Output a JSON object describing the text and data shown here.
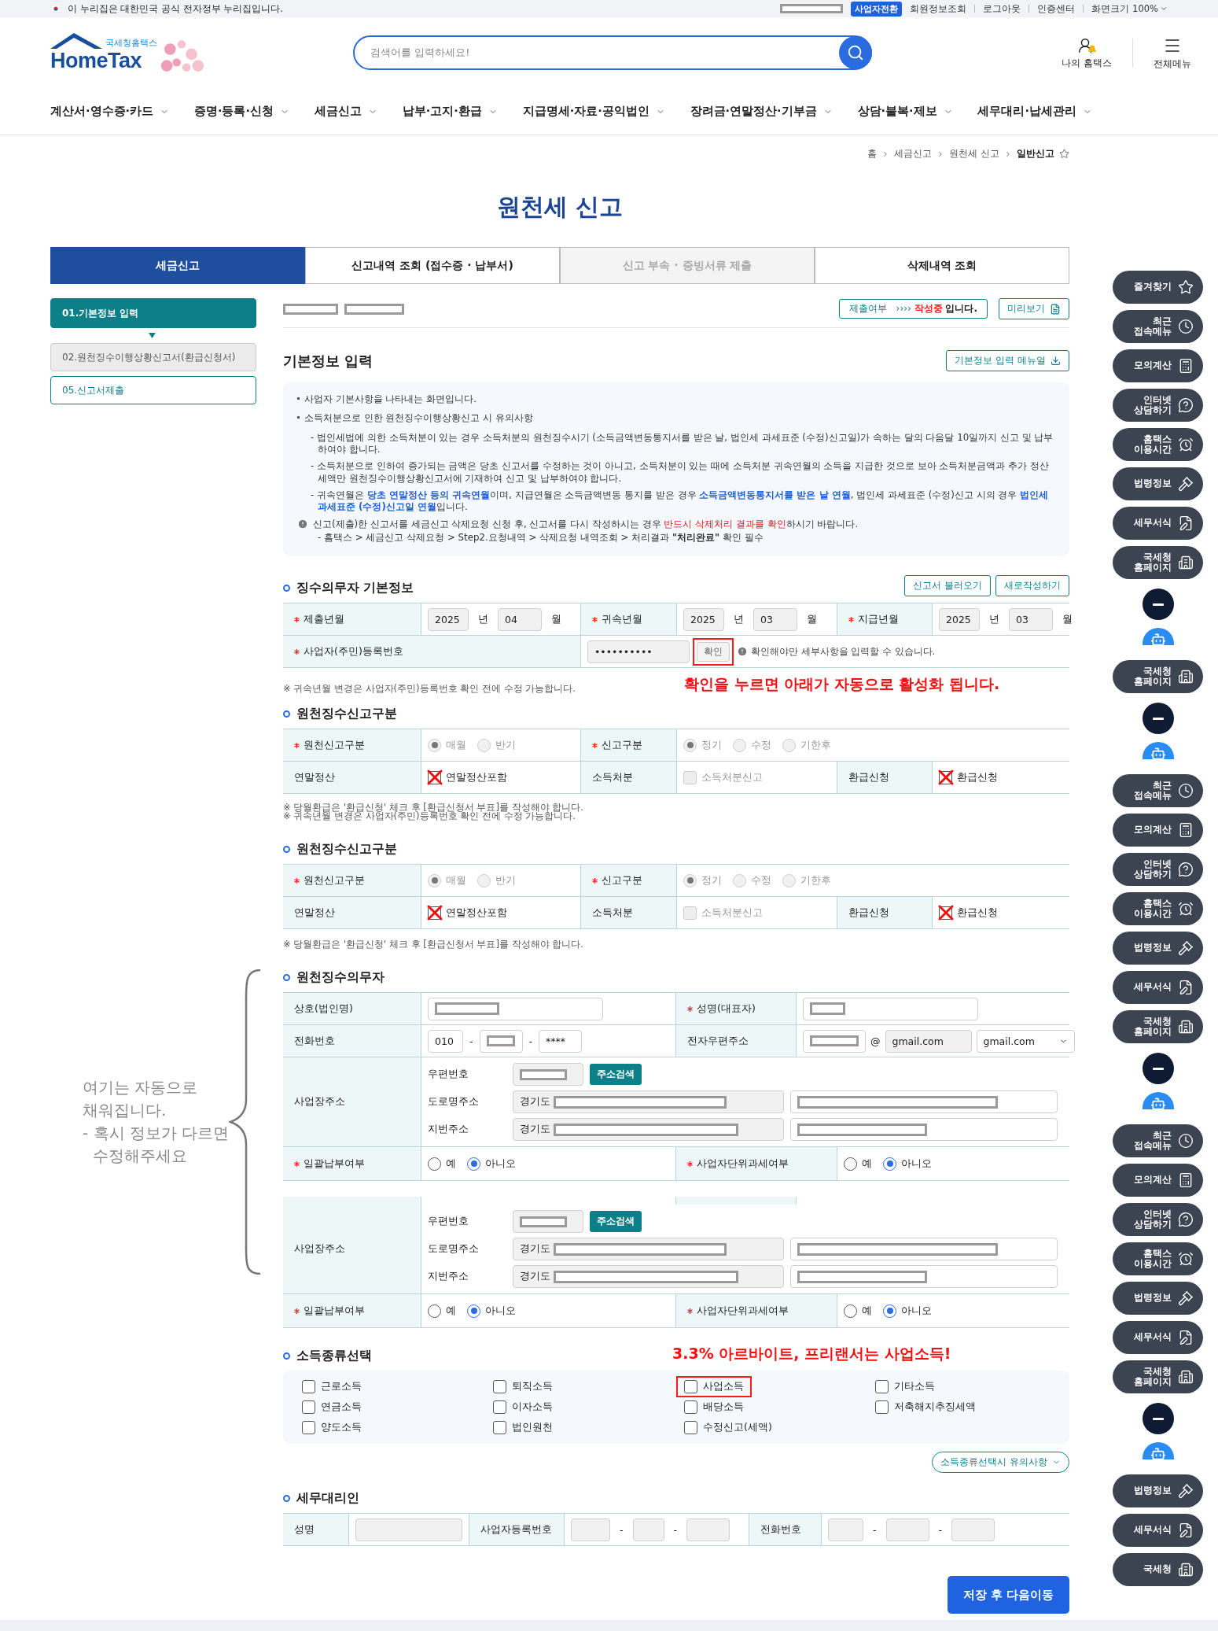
{
  "top_bar": {
    "notice": "이 누리집은 대한민국 공식 전자정부 누리집입니다.",
    "switch_button": "사업자전환",
    "links": [
      "회원정보조회",
      "로그아웃",
      "인증센터"
    ],
    "zoom": "화면크기 100%"
  },
  "header": {
    "logo_sub": "국세청홈택스",
    "logo": "HomeTax",
    "search": {
      "placeholder": "검색어를 입력하세요!"
    },
    "my_menu": "나의 홈택스",
    "all_menu": "전체메뉴"
  },
  "nav": [
    "계산서·영수증·카드",
    "증명·등록·신청",
    "세금신고",
    "납부·고지·환급",
    "지급명세·자료·공익법인",
    "장려금·연말정산·기부금",
    "상담·불복·제보",
    "세무대리·납세관리"
  ],
  "breadcrumb": [
    "홈",
    "세금신고",
    "원천세 신고",
    "일반신고"
  ],
  "page_title": "원천세 신고",
  "tabs": [
    {
      "label": "세금신고",
      "selected": true,
      "disabled": false
    },
    {
      "label": "신고내역 조회 (접수증 · 납부서)",
      "selected": false,
      "disabled": false
    },
    {
      "label": "신고 부속 · 증빙서류 제출",
      "selected": false,
      "disabled": true
    },
    {
      "label": "삭제내역 조회",
      "selected": false,
      "disabled": false
    }
  ],
  "steps": [
    {
      "label": "01.기본정보 입력",
      "selected": true,
      "disabled": false
    },
    {
      "label": "02.원천징수이행상황신고서(환급신청서)",
      "selected": false,
      "disabled": true
    },
    {
      "label": "05.신고서제출",
      "selected": false,
      "disabled": false
    }
  ],
  "side_note": "여기는 자동으로\n채워집니다.\n- 혹시 정보가 다르면\n  수정해주세요",
  "status": {
    "label": "제출여부",
    "arrows": "››››",
    "state": "작성중",
    "suffix": "입니다."
  },
  "preview_button": "미리보기",
  "basic": {
    "title": "기본정보 입력",
    "manual_button": "기본정보 입력 메뉴얼",
    "notices": [
      {
        "kind": "bullet",
        "segments": [
          {
            "text": "사업자 기본사항을 나타내는 화면입니다."
          }
        ]
      },
      {
        "kind": "bullet",
        "segments": [
          {
            "text": "소득처분으로 인한 원천징수이행상황신고 시 유의사항"
          }
        ]
      },
      {
        "kind": "dash",
        "segments": [
          {
            "text": "- 법인세법에 의한 소득처분이 있는 경우 소득처분의 원천징수시기 (소득금액변동통지서를 받은 날, 법인세 과세표준 (수정)신고일)가 속하는 달의 다음달 10일까지 신고 및 납부하여야 합니다."
          }
        ]
      },
      {
        "kind": "dash",
        "segments": [
          {
            "text": "- 소득처분으로 인하여 증가되는 금액은 당초 신고서를 수정하는 것이 아니고, 소득처분이 있는 때에 소득처분 귀속연월의 소득을 지급한 것으로 보아 소득처분금액과 추가 정산세액만 원천징수이행상황신고서에 기재하여 신고 및 납부하여야 합니다."
          }
        ]
      },
      {
        "kind": "dash",
        "segments": [
          {
            "text": "- 귀속연월은 "
          },
          {
            "text": "**당초 연말정산 등의 귀속연월**",
            "color": "#1f5fd8"
          },
          {
            "text": "이며, 지급연월은 소득금액변동 통지를 받은 경우 "
          },
          {
            "text": "**소득금액변동통지서를 받은 날 연월**",
            "color": "#1f5fd8"
          },
          {
            "text": ", 법인세 과세표준 (수정)신고 시의 경우 "
          },
          {
            "text": "**법인세 과세표준 (수정)신고일 연월**",
            "color": "#1f5fd8"
          },
          {
            "text": "입니다."
          }
        ]
      },
      {
        "kind": "alert",
        "segments": [
          {
            "text": "신고(제출)한 신고서를 세금신고 삭제요청 신청 후, 신고서를 다시 작성하시는 경우 "
          },
          {
            "text": "반드시 삭제처리 결과를 확인",
            "color": "#e02020"
          },
          {
            "text": "하시기 바랍니다."
          }
        ]
      },
      {
        "kind": "path",
        "segments": [
          {
            "text": "- 홈택스 > 세금신고 삭제요청 > Step2.요청내역 > 삭제요청 내역조회 > 처리결과 **\"처리완료\"** 확인 필수"
          }
        ]
      }
    ]
  },
  "withholder": {
    "title": "징수의무자 기본정보",
    "buttons": [
      "신고서 불러오기",
      "새로작성하기"
    ],
    "periods": [
      {
        "label": "제출년월",
        "required": true,
        "year": "2025",
        "year_unit": "년",
        "month": "04",
        "month_unit": "월"
      },
      {
        "label": "귀속년월",
        "required": true,
        "year": "2025",
        "year_unit": "년",
        "month": "03",
        "month_unit": "월"
      },
      {
        "label": "지급년월",
        "required": true,
        "year": "2025",
        "year_unit": "년",
        "month": "03",
        "month_unit": "월"
      }
    ],
    "registration": {
      "label": "사업자(주민)등록번호",
      "required": true,
      "value": "••••••••••",
      "confirm": "확인",
      "highlighted": true,
      "hint": "확인해야만 세부사항을 입력할 수 있습니다."
    },
    "note": "※ 귀속년월 변경은 사업자(주민)등록번호 확인 전에 수정 가능합니다.",
    "annotation": "확인을 누르면 아래가 자동으로 활성화 됩니다."
  },
  "report_types": [
    {
      "title": "원천징수신고구분",
      "radios": [
        {
          "label": "원천신고구분",
          "required": true,
          "disabled": true,
          "options": [
            {
              "label": "매월",
              "selected": true
            },
            {
              "label": "반기",
              "selected": false
            }
          ]
        },
        {
          "label": "신고구분",
          "required": true,
          "disabled": true,
          "options": [
            {
              "label": "정기",
              "selected": true
            },
            {
              "label": "수정",
              "selected": false
            },
            {
              "label": "기한후",
              "selected": false
            }
          ]
        }
      ],
      "checks": [
        {
          "label": "연말정산",
          "option": "연말정산포함",
          "checked": true,
          "disabled": false
        },
        {
          "label": "소득처분",
          "option": "소득처분신고",
          "checked": false,
          "disabled": true
        },
        {
          "label": "환급신청",
          "option": "환급신청",
          "checked": true,
          "disabled": false
        }
      ],
      "notes": [
        "※ 당월환급은 '환급신청' 체크 후 [환급신청서 부표]를 작성해야 합니다.",
        "※ 귀속년월 변경은 사업자(주민)등록번호 확인 전에 수정 가능합니다."
      ]
    },
    {
      "title": "원천징수신고구분",
      "radios": [
        {
          "label": "원천신고구분",
          "required": true,
          "disabled": true,
          "options": [
            {
              "label": "매월",
              "selected": true
            },
            {
              "label": "반기",
              "selected": false
            }
          ]
        },
        {
          "label": "신고구분",
          "required": true,
          "disabled": true,
          "options": [
            {
              "label": "정기",
              "selected": true
            },
            {
              "label": "수정",
              "selected": false
            },
            {
              "label": "기한후",
              "selected": false
            }
          ]
        }
      ],
      "checks": [
        {
          "label": "연말정산",
          "option": "연말정산포함",
          "checked": true,
          "disabled": false
        },
        {
          "label": "소득처분",
          "option": "소득처분신고",
          "checked": false,
          "disabled": true
        },
        {
          "label": "환급신청",
          "option": "환급신청",
          "checked": true,
          "disabled": false
        }
      ],
      "notes": [
        "※ 당월환급은 '환급신청' 체크 후 [환급신청서 부표]를 작성해야 합니다."
      ]
    }
  ],
  "payer": {
    "title": "원천징수의무자",
    "blocks": [
      {
        "company": {
          "label": "상호(법인명)",
          "required": false
        },
        "representative": {
          "label": "성명(대표자)",
          "required": true
        },
        "phone": {
          "label": "전화번호",
          "separator": "-",
          "fields": [
            {
              "value": "010",
              "redacted": false
            },
            {
              "redacted": true
            },
            {
              "value": "****",
              "redacted": false
            }
          ]
        },
        "email": {
          "label": "전자우편주소",
          "redacted": true,
          "at": "@",
          "domain": "gmail.com",
          "select": "gmail.com"
        },
        "address": {
          "label": "사업장주소",
          "zip_label": "우편번호",
          "search_button": "주소검색",
          "lines": [
            {
              "label": "도로명주소",
              "prefix": "경기도"
            },
            {
              "label": "지번주소",
              "prefix": "경기도"
            }
          ]
        },
        "flags": [
          {
            "label": "일괄납부여부",
            "required": true,
            "options": [
              {
                "label": "예",
                "selected": false
              },
              {
                "label": "아니오",
                "selected": true
              }
            ]
          },
          {
            "label": "사업자단위과세여부",
            "required": true,
            "options": [
              {
                "label": "예",
                "selected": false
              },
              {
                "label": "아니오",
                "selected": true
              }
            ]
          }
        ]
      },
      {
        "address": {
          "label": "사업장주소",
          "zip_label": "우편번호",
          "search_button": "주소검색",
          "lines": [
            {
              "label": "도로명주소",
              "prefix": "경기도"
            },
            {
              "label": "지번주소",
              "prefix": "경기도"
            }
          ]
        },
        "flags": [
          {
            "label": "일괄납부여부",
            "required": true,
            "options": [
              {
                "label": "예",
                "selected": false
              },
              {
                "label": "아니오",
                "selected": true
              }
            ]
          },
          {
            "label": "사업자단위과세여부",
            "required": true,
            "options": [
              {
                "label": "예",
                "selected": false
              },
              {
                "label": "아니오",
                "selected": true
              }
            ]
          }
        ]
      }
    ]
  },
  "income": {
    "title": "소득종류선택",
    "annotation": "3.3% 아르바이트, 프리랜서는 사업소득!",
    "notice_button": "소득종류선택시 유의사항",
    "options": [
      {
        "label": "근로소득",
        "checked": false,
        "highlighted": false
      },
      {
        "label": "퇴직소득",
        "checked": false,
        "highlighted": false
      },
      {
        "label": "사업소득",
        "checked": false,
        "highlighted": true
      },
      {
        "label": "기타소득",
        "checked": false,
        "highlighted": false
      },
      {
        "label": "연금소득",
        "checked": false,
        "highlighted": false
      },
      {
        "label": "이자소득",
        "checked": false,
        "highlighted": false
      },
      {
        "label": "배당소득",
        "checked": false,
        "highlighted": false
      },
      {
        "label": "저축해지추징세액",
        "checked": false,
        "highlighted": false
      },
      {
        "label": "양도소득",
        "checked": false,
        "highlighted": false
      },
      {
        "label": "법인원천",
        "checked": false,
        "highlighted": false
      },
      {
        "label": "수정신고(세액)",
        "checked": false,
        "highlighted": false
      }
    ]
  },
  "agent": {
    "title": "세무대리인",
    "name_label": "성명",
    "reg_label": "사업자등록번호",
    "phone_label": "전화번호",
    "separator": "-"
  },
  "save_button": "저장 후 다음이동",
  "rail": [
    {
      "kind": "favorites",
      "label": "즐겨찾기"
    },
    {
      "kind": "recent",
      "label": "최근\n접속메뉴"
    },
    {
      "kind": "calculator",
      "label": "모의계산"
    },
    {
      "kind": "chat",
      "label": "인터넷\n상담하기"
    },
    {
      "kind": "hours",
      "label": "홈택스\n이용시간"
    },
    {
      "kind": "law",
      "label": "법령정보"
    },
    {
      "kind": "forms",
      "label": "세무서식"
    },
    {
      "kind": "homepage",
      "label": "국세청\n홈페이지"
    },
    {
      "kind": "collapse"
    },
    {
      "kind": "chatbot"
    },
    {
      "kind": "homepage",
      "label": "국세청\n홈페이지"
    },
    {
      "kind": "collapse"
    },
    {
      "kind": "chatbot"
    },
    {
      "kind": "recent",
      "label": "최근\n접속메뉴"
    },
    {
      "kind": "calculator",
      "label": "모의계산"
    },
    {
      "kind": "chat",
      "label": "인터넷\n상담하기"
    },
    {
      "kind": "hours",
      "label": "홈택스\n이용시간"
    },
    {
      "kind": "law",
      "label": "법령정보"
    },
    {
      "kind": "forms",
      "label": "세무서식"
    },
    {
      "kind": "homepage",
      "label": "국세청\n홈페이지"
    },
    {
      "kind": "collapse"
    },
    {
      "kind": "chatbot"
    },
    {
      "kind": "recent",
      "label": "최근\n접속메뉴"
    },
    {
      "kind": "calculator",
      "label": "모의계산"
    },
    {
      "kind": "chat",
      "label": "인터넷\n상담하기"
    },
    {
      "kind": "hours",
      "label": "홈택스\n이용시간"
    },
    {
      "kind": "law",
      "label": "법령정보"
    },
    {
      "kind": "forms",
      "label": "세무서식"
    },
    {
      "kind": "homepage",
      "label": "국세청\n홈페이지"
    },
    {
      "kind": "collapse"
    },
    {
      "kind": "chatbot"
    },
    {
      "kind": "law",
      "label": "법령정보"
    },
    {
      "kind": "forms",
      "label": "세무서식"
    },
    {
      "kind": "homepage",
      "label": "국세청"
    }
  ]
}
